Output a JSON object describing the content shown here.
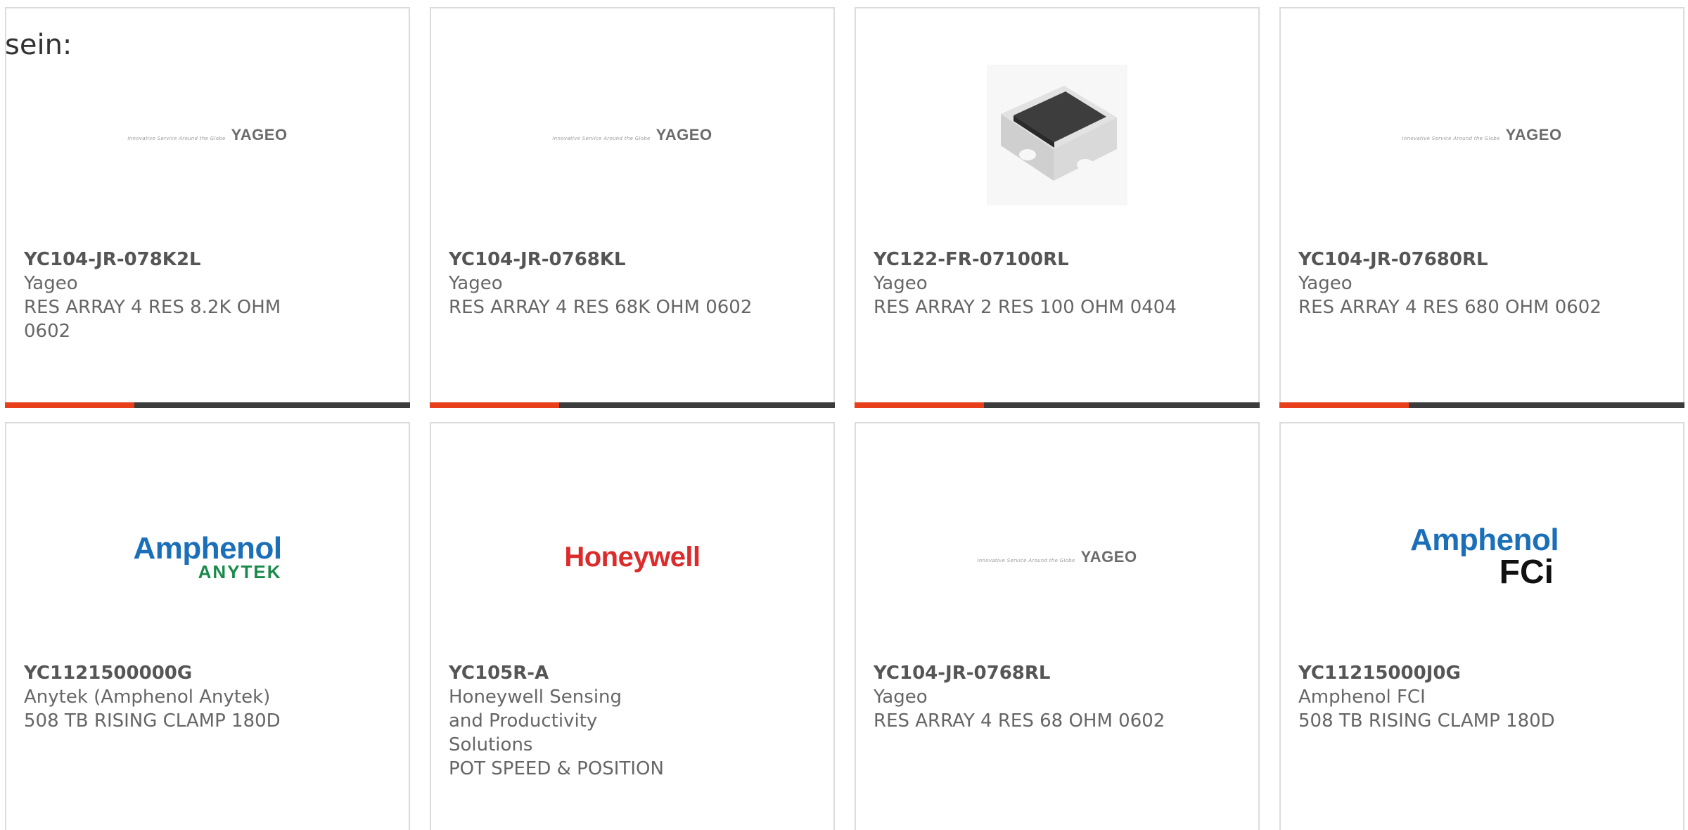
{
  "intro_text": "sein:",
  "products": [
    {
      "part_number": "YC104-JR-078K2L",
      "manufacturer": "Yageo",
      "description": "RES ARRAY 4 RES 8.2K OHM 0602",
      "image": "yageo-logo"
    },
    {
      "part_number": "YC104-JR-0768KL",
      "manufacturer": "Yageo",
      "description": "RES ARRAY 4 RES 68K OHM 0602",
      "image": "yageo-logo"
    },
    {
      "part_number": "YC122-FR-07100RL",
      "manufacturer": "Yageo",
      "description": "RES ARRAY 2 RES 100 OHM 0404",
      "image": "resistor-array-chip-photo"
    },
    {
      "part_number": "YC104-JR-07680RL",
      "manufacturer": "Yageo",
      "description": "RES ARRAY 4 RES 680 OHM 0602",
      "image": "yageo-logo"
    },
    {
      "part_number": "YC1121500000G",
      "manufacturer": "Anytek (Amphenol Anytek)",
      "description": "508 TB RISING CLAMP 180D",
      "image": "amphenol-anytek-logo"
    },
    {
      "part_number": "YC105R-A",
      "manufacturer": "Honeywell Sensing and Productivity Solutions",
      "description": "POT SPEED & POSITION",
      "image": "honeywell-logo"
    },
    {
      "part_number": "YC104-JR-0768RL",
      "manufacturer": "Yageo",
      "description": "RES ARRAY 4 RES 68 OHM 0602",
      "image": "yageo-logo"
    },
    {
      "part_number": "YC11215000J0G",
      "manufacturer": "Amphenol FCI",
      "description": "508 TB RISING CLAMP 180D",
      "image": "amphenol-fci-logo"
    }
  ],
  "logos": {
    "yageo_tagline": "Innovative Service Around the Globe",
    "yageo_name": "YAGEO",
    "amphenol": "Amphenol",
    "anytek": "ANYTEK",
    "honeywell": "Honeywell",
    "fci": "FCi"
  },
  "colors": {
    "accent_bar": "#e8401c",
    "bar": "#3c3c3c",
    "card_border": "#dcdcdc"
  }
}
